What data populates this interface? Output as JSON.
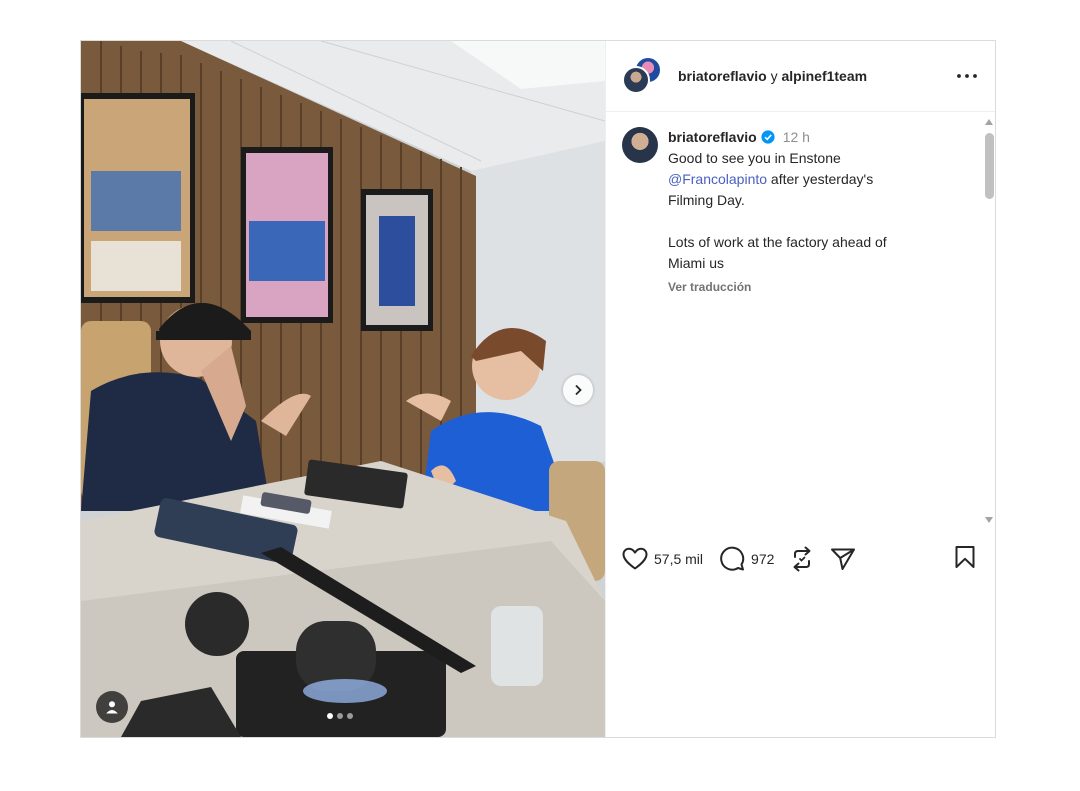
{
  "header": {
    "user1": "briatoreflavio",
    "connector": " y ",
    "user2": "alpinef1team"
  },
  "caption": {
    "username": "briatoreflavio",
    "time": "12 h",
    "line1": "Good to see you in Enstone",
    "mention": "@Francolapinto",
    "line2": " after yesterday's\nFilming Day.\n\nLots of work at the factory ahead of\nMiami us",
    "translate": "Ver traducción"
  },
  "actions": {
    "likes": "57,5 mil",
    "comments": "972"
  },
  "media": {
    "carousel_total": 3,
    "carousel_active": 0
  },
  "colors": {
    "verified": "#0095f6",
    "mention": "#4a5fc1",
    "muted": "#737373"
  },
  "icons": [
    "more-icon",
    "verified-icon",
    "heart-icon",
    "comment-icon",
    "repost-icon",
    "share-icon",
    "bookmark-icon",
    "chevron-right-icon",
    "user-tag-icon"
  ]
}
